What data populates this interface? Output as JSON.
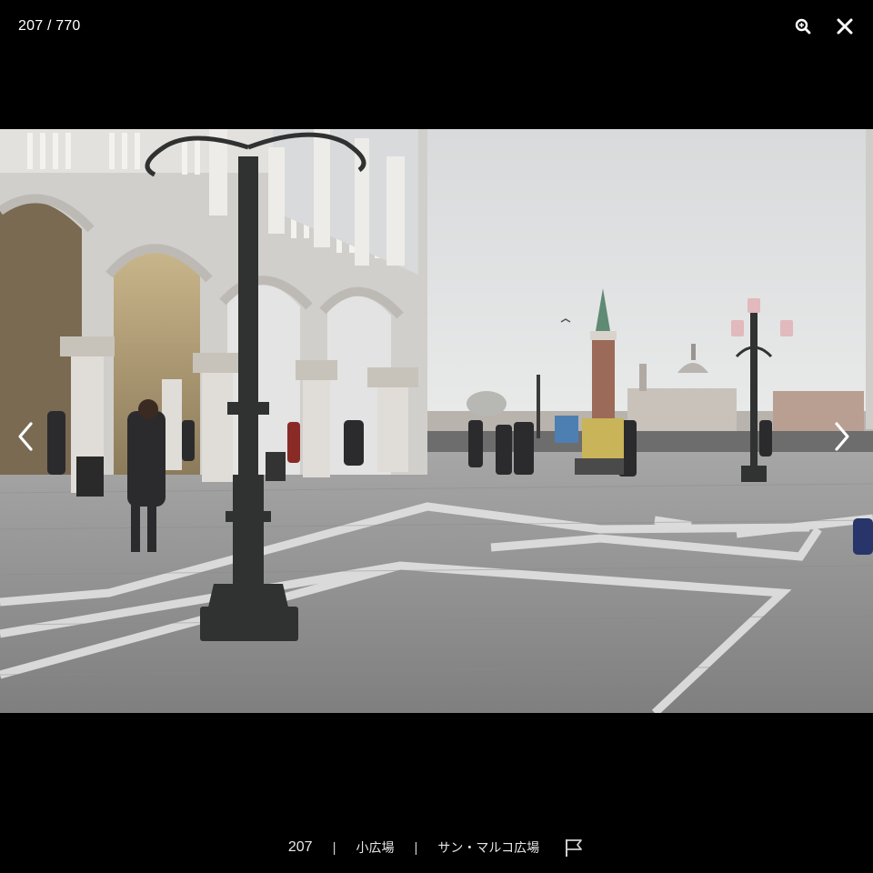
{
  "viewer": {
    "counter": "207 / 770",
    "zoom_icon": "zoom-in-icon",
    "close_icon": "close-icon",
    "prev_icon": "chevron-left-icon",
    "next_icon": "chevron-right-icon"
  },
  "caption": {
    "photo_number": "207",
    "separator": "|",
    "tag_1": "小広場",
    "tag_2": "サン・マルコ広場",
    "report_icon": "flag-icon"
  },
  "colors": {
    "background": "#000000",
    "text": "#ffffff"
  }
}
